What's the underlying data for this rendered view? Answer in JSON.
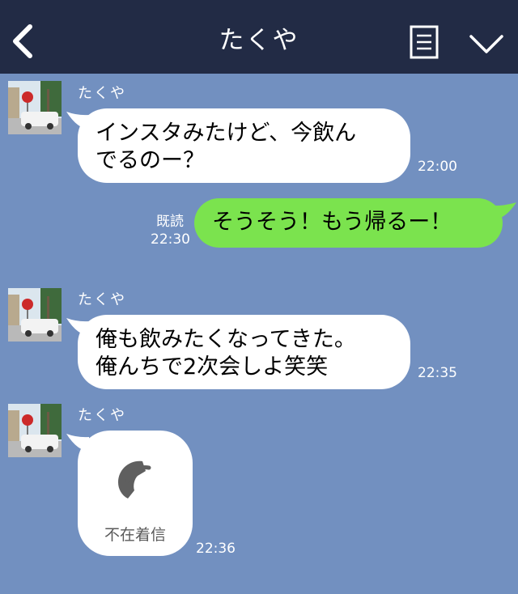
{
  "header": {
    "title": "たくや",
    "back_icon": "chevron-left-icon",
    "notes_icon": "notes-icon",
    "menu_icon": "chevron-down-icon",
    "background": "#222b45"
  },
  "chat": {
    "background": "#7290c0",
    "messages": [
      {
        "direction": "incoming",
        "sender": "たくや",
        "line1": "インスタみたけど、今飲ん",
        "line2": "でるのー？",
        "time": "22:00"
      },
      {
        "direction": "outgoing",
        "read_label": "既読",
        "time": "22:30",
        "text": "そうそう！もう帰るー！"
      },
      {
        "direction": "incoming",
        "sender": "たくや",
        "line1": "俺も飲みたくなってきた。",
        "line2": "俺んちで2次会しよ笑笑",
        "time": "22:35"
      },
      {
        "direction": "incoming",
        "sender": "たくや",
        "type": "missed-call",
        "call_icon": "phone-icon",
        "label": "不在着信",
        "time": "22:36"
      }
    ]
  },
  "colors": {
    "incoming_bubble": "#ffffff",
    "outgoing_bubble": "#7be34e"
  }
}
